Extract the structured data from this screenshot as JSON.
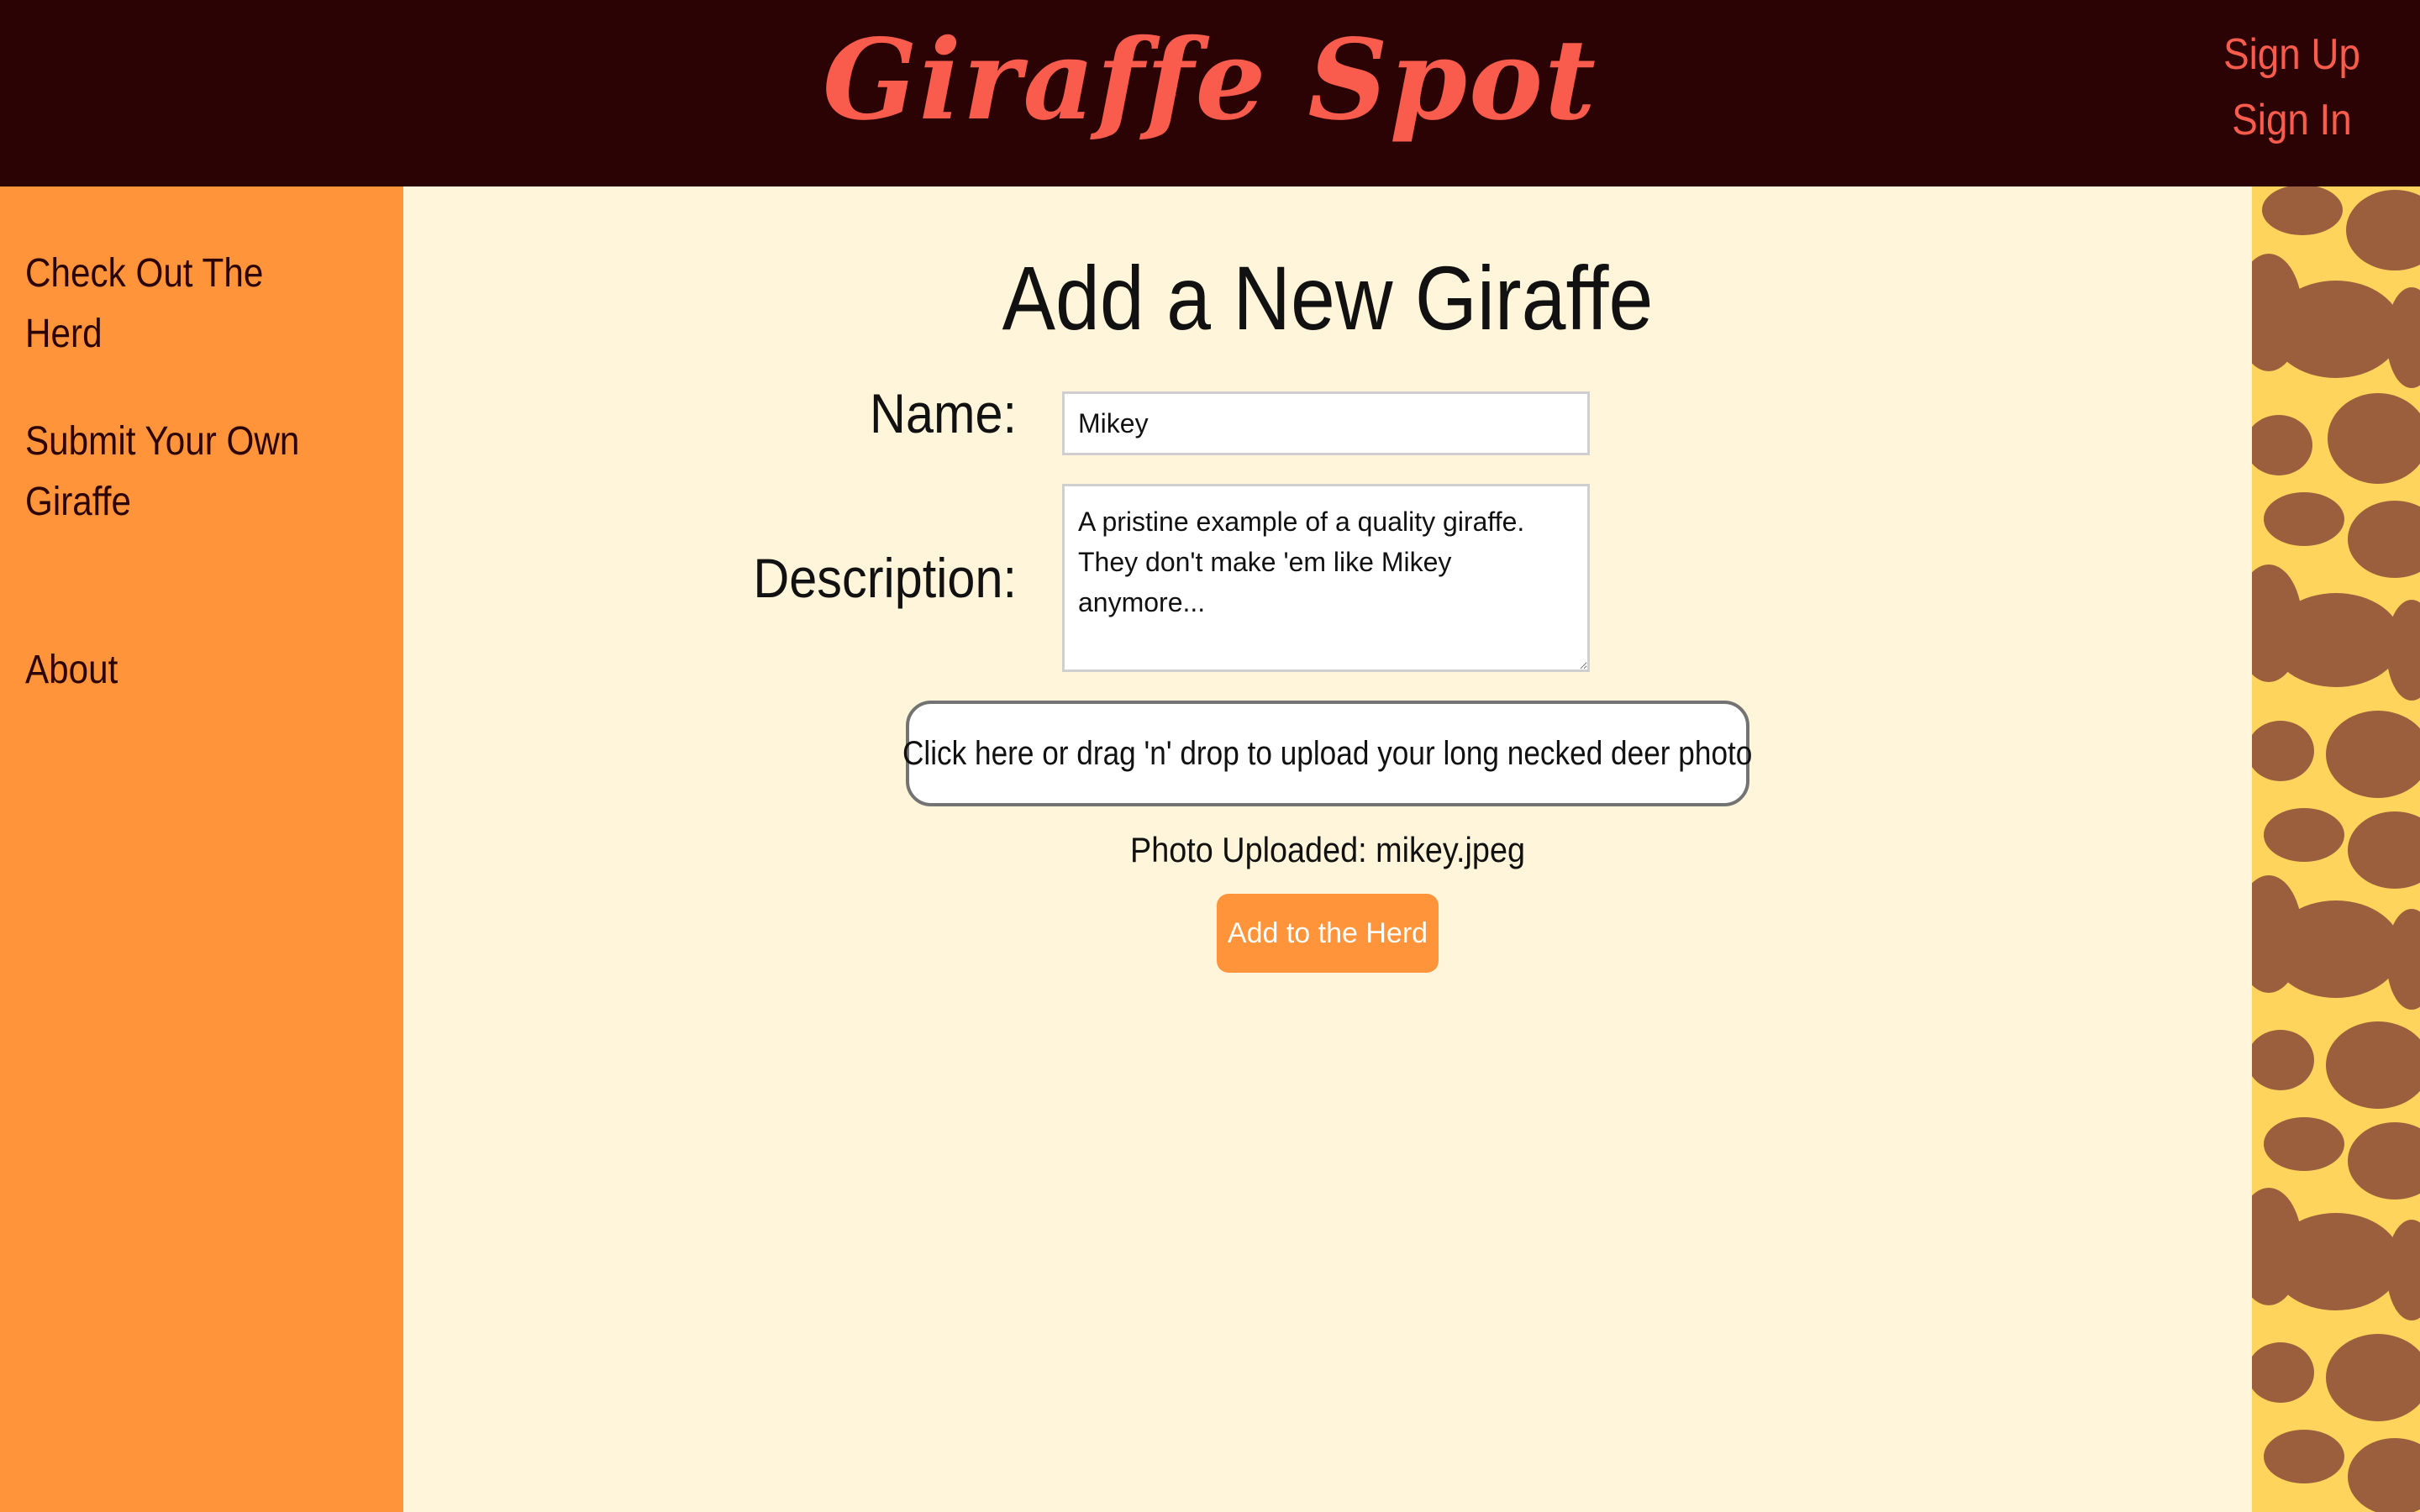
{
  "header": {
    "logo": "Giraffe Spot",
    "sign_up": "Sign Up",
    "sign_in": "Sign In"
  },
  "sidebar": {
    "items": [
      {
        "label": "Check Out The Herd"
      },
      {
        "label": "Submit Your Own Giraffe"
      },
      {
        "label": "About"
      }
    ]
  },
  "form": {
    "title": "Add a New Giraffe",
    "name_label": "Name:",
    "name_value": "Mikey",
    "description_label": "Description:",
    "description_value": "A pristine example of a quality giraffe. They don't make 'em like Mikey anymore...",
    "dropzone_text": "Click here or drag 'n' drop to upload your long necked deer photo",
    "uploaded_text": "Photo Uploaded: mikey.jpeg",
    "submit_label": "Add to the Herd"
  },
  "colors": {
    "header_bg": "#2b0304",
    "brand": "#f95c4c",
    "sidebar_bg": "#ff943b",
    "main_bg": "#fff5da",
    "pattern_bg": "#ffd45c",
    "pattern_spot": "#9c5f3e"
  }
}
